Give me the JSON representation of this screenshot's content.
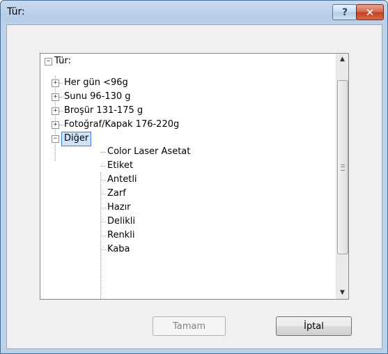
{
  "window": {
    "title": "Tür:",
    "help_label": "?",
    "close_label": "✕"
  },
  "tree": {
    "root": {
      "toggle": "−",
      "label": "Tür:"
    },
    "categories": [
      {
        "toggle": "+",
        "label": "Her gün <96g"
      },
      {
        "toggle": "+",
        "label": "Sunu 96-130 g"
      },
      {
        "toggle": "+",
        "label": "Broşür 131-175 g"
      },
      {
        "toggle": "+",
        "label": "Fotoğraf/Kapak 176-220g"
      },
      {
        "toggle": "−",
        "label": "Diğer"
      }
    ],
    "children": [
      "Color Laser Asetat",
      "Etiket",
      "Antetli",
      "Zarf",
      "Hazır",
      "Delikli",
      "Renkli",
      "Kaba"
    ],
    "selected": "Diğer"
  },
  "scrollbar": {
    "up": "▲",
    "down": "▼"
  },
  "buttons": {
    "ok": "Tamam",
    "cancel": "İptal"
  }
}
